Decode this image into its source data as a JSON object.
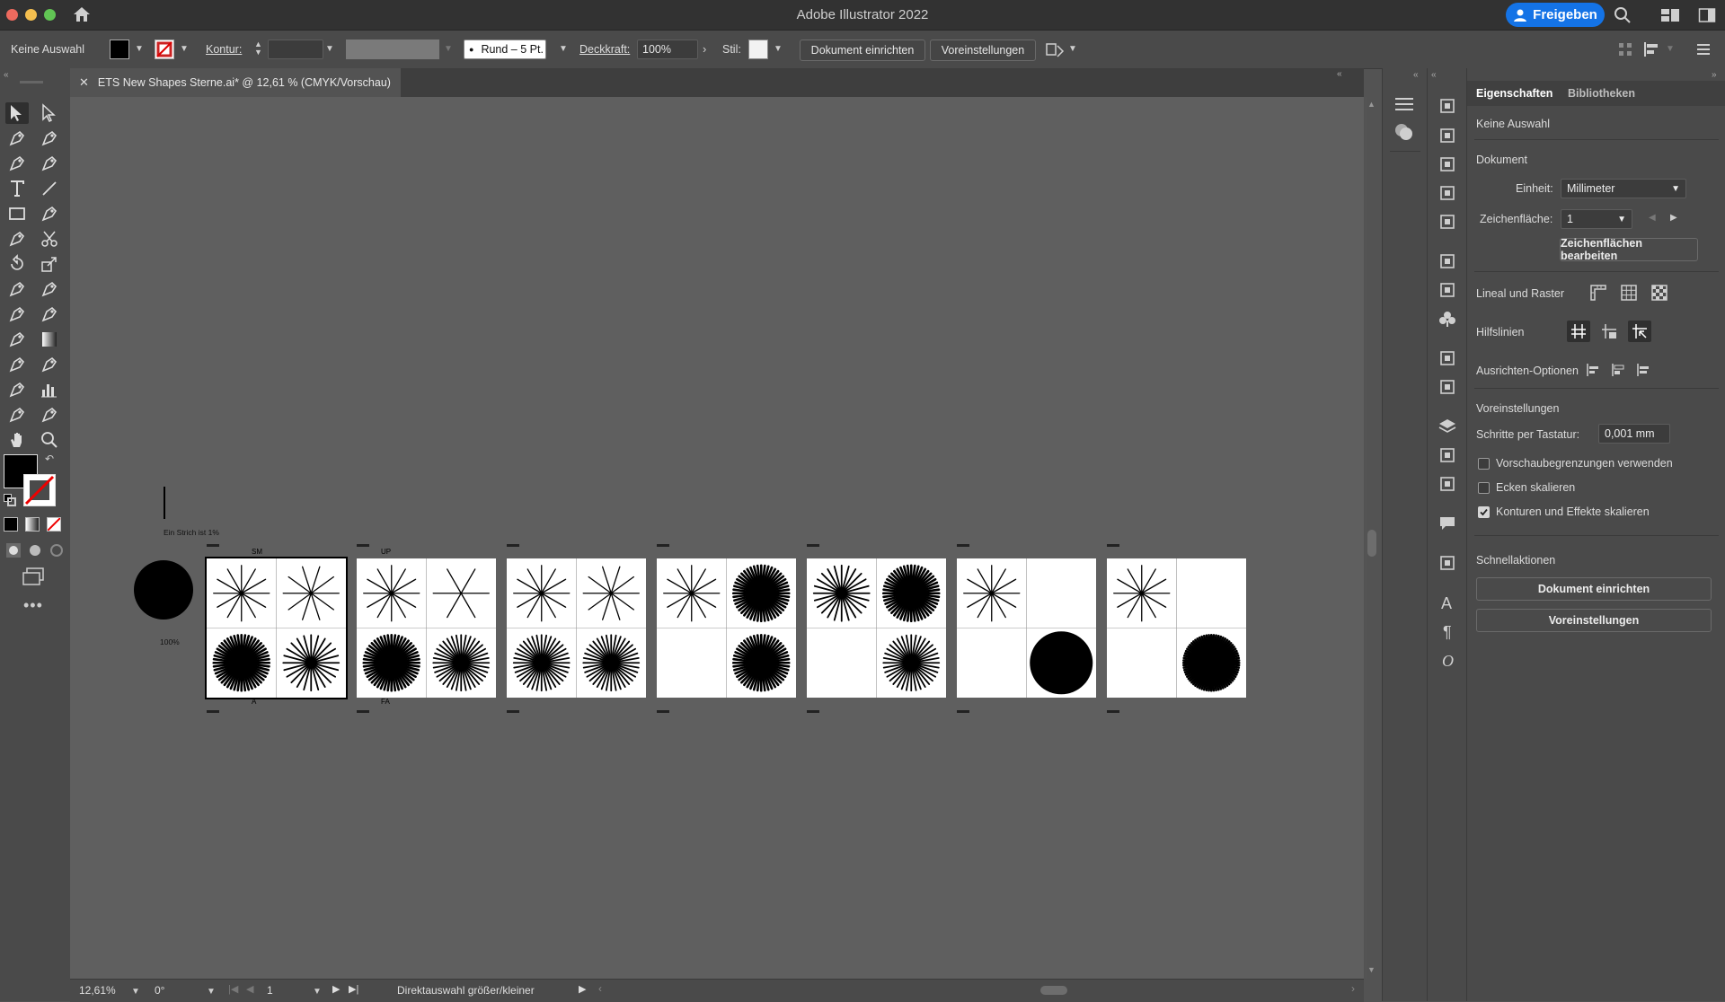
{
  "app": {
    "title": "Adobe Illustrator 2022",
    "share_label": "Freigeben"
  },
  "control": {
    "selection": "Keine Auswahl",
    "stroke_label": "Kontur:",
    "brush": "Rund – 5 Pt.",
    "opacity_label": "Deckkraft:",
    "opacity_value": "100%",
    "style_label": "Stil:",
    "doc_setup": "Dokument einrichten",
    "prefs": "Voreinstellungen"
  },
  "document": {
    "tab_title": "ETS New Shapes Sterne.ai* @ 12,61 % (CMYK/Vorschau)"
  },
  "canvas": {
    "note_text": "Ein Strich ist 1%",
    "dot_label": "100%",
    "corner_labels": {
      "tl": "SM",
      "tr": "UP",
      "bl": "A",
      "br": "FA"
    }
  },
  "status": {
    "zoom": "12,61%",
    "rotation": "0°",
    "artboard": "1",
    "tool_info": "Direktauswahl größer/kleiner"
  },
  "panel": {
    "tabs": [
      "Eigenschaften",
      "Bibliotheken"
    ],
    "no_selection": "Keine Auswahl",
    "document_heading": "Dokument",
    "unit_label": "Einheit:",
    "unit_value": "Millimeter",
    "artboard_label": "Zeichenfläche:",
    "artboard_value": "1",
    "edit_artboards": "Zeichenflächen bearbeiten",
    "rulers_grids": "Lineal und Raster",
    "guides": "Hilfslinien",
    "align_options": "Ausrichten-Optionen",
    "preferences_heading": "Voreinstellungen",
    "keyboard_increment_label": "Schritte per Tastatur:",
    "keyboard_increment_value": "0,001 mm",
    "checkboxes": [
      {
        "label": "Vorschaubegrenzungen verwenden",
        "checked": false
      },
      {
        "label": "Ecken skalieren",
        "checked": false
      },
      {
        "label": "Konturen und Effekte skalieren",
        "checked": true
      }
    ],
    "quick_actions": "Schnellaktionen",
    "doc_setup_btn": "Dokument einrichten",
    "prefs_btn": "Voreinstellungen"
  },
  "artboards": [
    [
      "star-12",
      "star-10",
      "star-48",
      "star-24"
    ],
    [
      "star-12",
      "star-6",
      "star-48",
      "star-36"
    ],
    [
      "star-12",
      "star-10",
      "star-36",
      "star-36"
    ],
    [
      "star-12",
      "star-48",
      "empty",
      "star-48"
    ],
    [
      "star-24",
      "star-48",
      "empty",
      "star-36"
    ],
    [
      "star-12",
      "empty",
      "empty",
      "disc"
    ],
    [
      "star-12",
      "empty",
      "empty",
      "star-72"
    ]
  ],
  "colors": {
    "accent": "#1473e6",
    "canvas": "#5f5f5f",
    "chrome": "#4a4a4a"
  }
}
